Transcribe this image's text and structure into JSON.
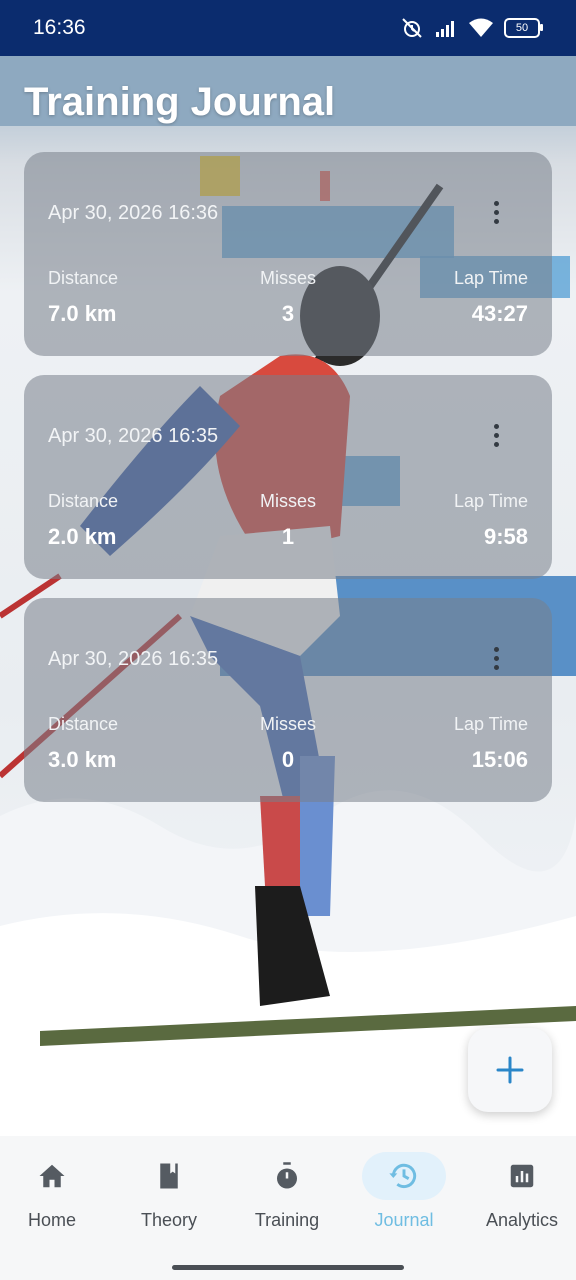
{
  "status_bar": {
    "time": "16:36",
    "battery": "50"
  },
  "page": {
    "title": "Training Journal"
  },
  "entries": [
    {
      "date": "Apr 30, 2026 16:36",
      "distance_label": "Distance",
      "distance": "7.0 km",
      "misses_label": "Misses",
      "misses": "3",
      "lap_label": "Lap Time",
      "lap_time": "43:27"
    },
    {
      "date": "Apr 30, 2026 16:35",
      "distance_label": "Distance",
      "distance": "2.0 km",
      "misses_label": "Misses",
      "misses": "1",
      "lap_label": "Lap Time",
      "lap_time": "9:58"
    },
    {
      "date": "Apr 30, 2026 16:35",
      "distance_label": "Distance",
      "distance": "3.0 km",
      "misses_label": "Misses",
      "misses": "0",
      "lap_label": "Lap Time",
      "lap_time": "15:06"
    }
  ],
  "fab": {
    "icon": "plus-icon"
  },
  "nav": [
    {
      "label": "Home",
      "icon": "home-icon"
    },
    {
      "label": "Theory",
      "icon": "book-icon"
    },
    {
      "label": "Training",
      "icon": "stopwatch-icon"
    },
    {
      "label": "Journal",
      "icon": "history-icon",
      "active": true
    },
    {
      "label": "Analytics",
      "icon": "analytics-icon"
    }
  ],
  "colors": {
    "accent": "#2a86c8",
    "nav_active": "#6fbde2",
    "status_bar": "#0b2c6e"
  }
}
